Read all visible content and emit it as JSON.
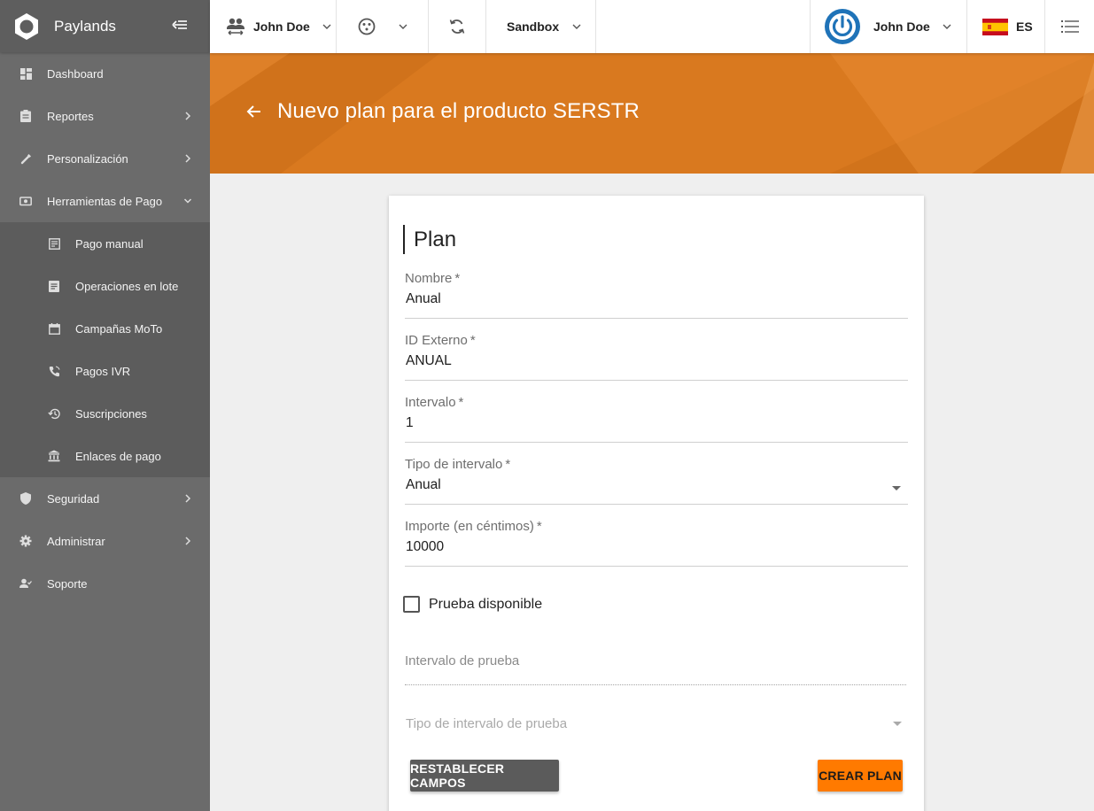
{
  "app": {
    "name": "Paylands",
    "brand_color": "#d9791f",
    "accent_color": "#ff7a00"
  },
  "sidebar": {
    "items": [
      {
        "label": "Dashboard",
        "icon": "dashboard-icon"
      },
      {
        "label": "Reportes",
        "icon": "clipboard-icon"
      },
      {
        "label": "Personalización",
        "icon": "brush-icon"
      },
      {
        "label": "Herramientas de Pago",
        "icon": "payments-icon",
        "expanded": true
      },
      {
        "label": "Pago manual",
        "icon": "receipt-icon"
      },
      {
        "label": "Operaciones en lote",
        "icon": "document-list-icon"
      },
      {
        "label": "Campañas MoTo",
        "icon": "calendar-icon"
      },
      {
        "label": "Pagos IVR",
        "icon": "phone-call-icon"
      },
      {
        "label": "Suscripciones",
        "icon": "history-icon"
      },
      {
        "label": "Enlaces de pago",
        "icon": "bank-icon"
      },
      {
        "label": "Seguridad",
        "icon": "shield-icon"
      },
      {
        "label": "Administrar",
        "icon": "gear-icon"
      },
      {
        "label": "Soporte",
        "icon": "support-person-icon"
      }
    ]
  },
  "topbar": {
    "account_user": "John Doe",
    "environment": "Sandbox",
    "profile_user": "John Doe",
    "language": "ES"
  },
  "banner": {
    "title": "Nuevo plan para el producto SERSTR"
  },
  "form": {
    "title": "Plan",
    "required_mark": "*",
    "fields": [
      {
        "label": "Nombre",
        "value": "Anual"
      },
      {
        "label": "ID Externo",
        "value": "ANUAL"
      },
      {
        "label": "Intervalo",
        "value": "1"
      },
      {
        "label": "Tipo de intervalo",
        "value": "Anual"
      },
      {
        "label": "Importe (en céntimos)",
        "value": "10000"
      }
    ],
    "trial_checkbox": {
      "label": "Prueba disponible",
      "checked": false
    },
    "trial_interval_placeholder": "Intervalo de prueba",
    "trial_interval_type_placeholder": "Tipo de intervalo de prueba",
    "reset_button": "RESTABLECER CAMPOS",
    "create_button": "CREAR PLAN"
  }
}
